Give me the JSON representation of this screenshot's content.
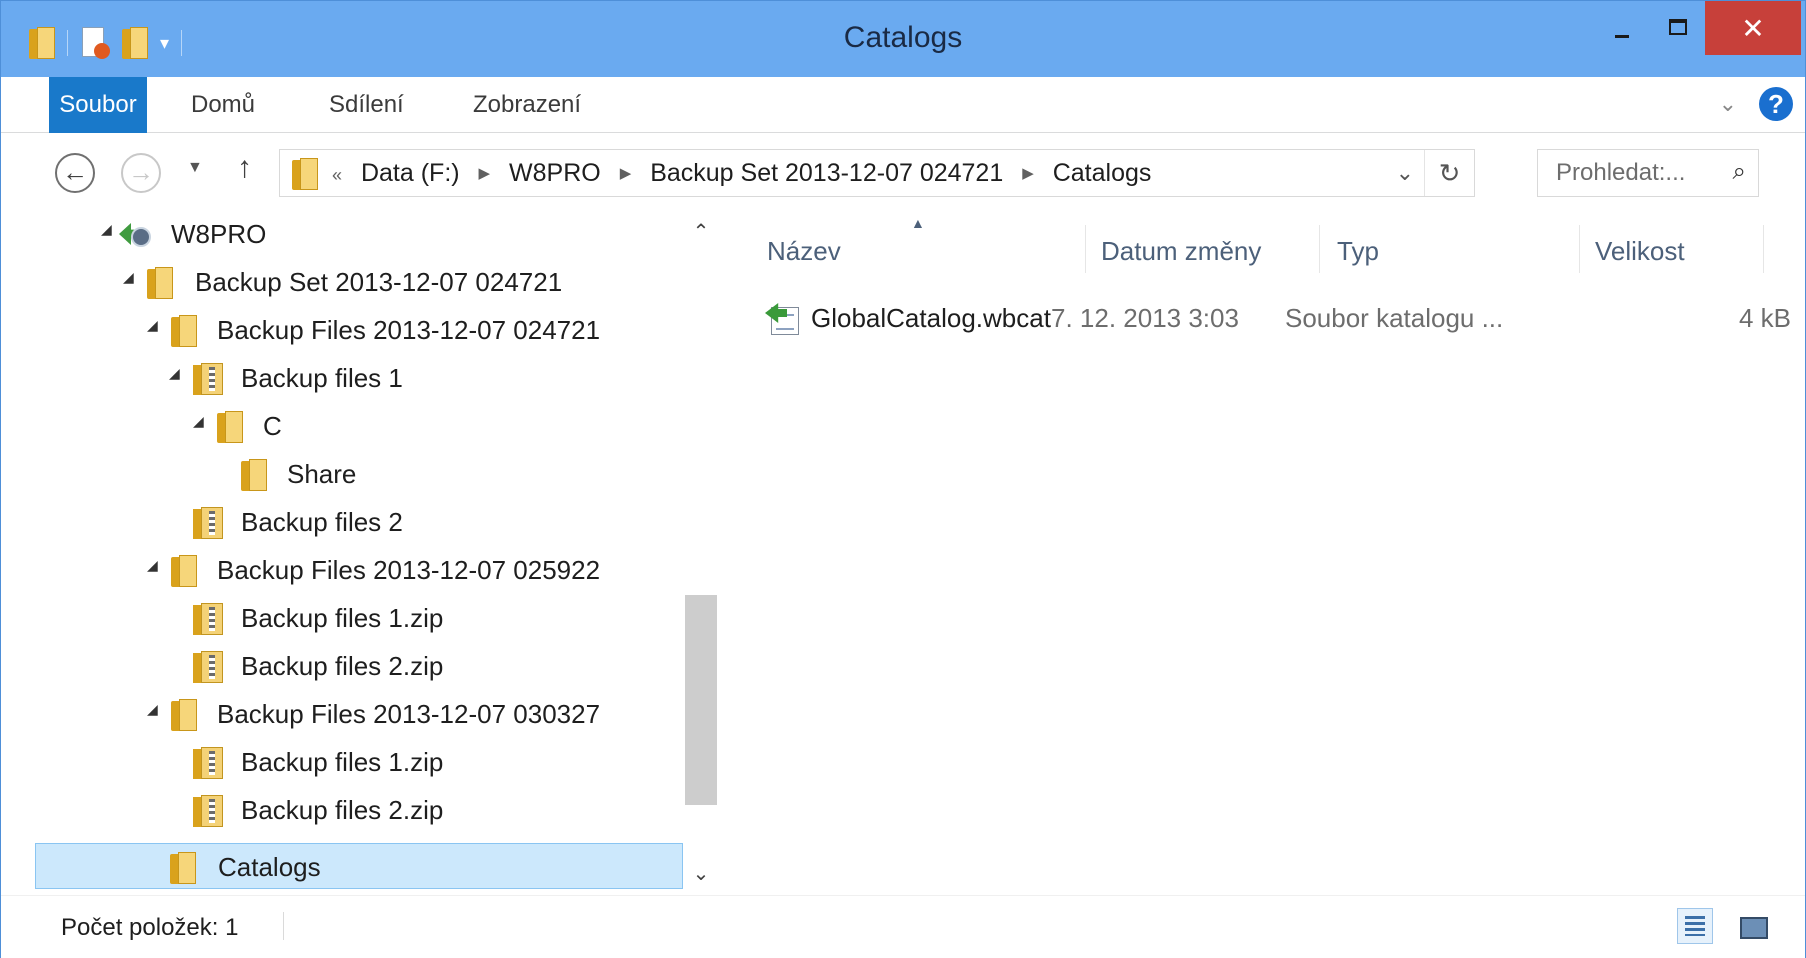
{
  "window": {
    "title": "Catalogs"
  },
  "ribbon": {
    "tabs": [
      {
        "label": "Soubor"
      },
      {
        "label": "Domů"
      },
      {
        "label": "Sdílení"
      },
      {
        "label": "Zobrazení"
      }
    ],
    "help_label": "?"
  },
  "navigation": {
    "address_parts": [
      "«",
      "Data (F:)",
      "W8PRO",
      "Backup Set 2013-12-07 024721",
      "Catalogs"
    ],
    "search_placeholder": "Prohledat:..."
  },
  "tree": {
    "items": [
      {
        "label": "W8PRO",
        "icon": "computer-backup-icon"
      },
      {
        "label": "Backup Set 2013-12-07 024721",
        "icon": "folder-icon"
      },
      {
        "label": "Backup Files 2013-12-07 024721",
        "icon": "folder-icon"
      },
      {
        "label": "Backup files 1",
        "icon": "zip-folder-icon"
      },
      {
        "label": "C",
        "icon": "folder-icon"
      },
      {
        "label": "Share",
        "icon": "folder-icon"
      },
      {
        "label": "Backup files 2",
        "icon": "zip-folder-icon"
      },
      {
        "label": "Backup Files 2013-12-07 025922",
        "icon": "folder-icon"
      },
      {
        "label": "Backup files 1.zip",
        "icon": "zip-folder-icon"
      },
      {
        "label": "Backup files 2.zip",
        "icon": "zip-folder-icon"
      },
      {
        "label": "Backup Files 2013-12-07 030327",
        "icon": "folder-icon"
      },
      {
        "label": "Backup files 1.zip",
        "icon": "zip-folder-icon"
      },
      {
        "label": "Backup files 2.zip",
        "icon": "zip-folder-icon"
      },
      {
        "label": "Catalogs",
        "icon": "folder-icon",
        "selected": true
      }
    ]
  },
  "file_list": {
    "columns": [
      {
        "label": "Název"
      },
      {
        "label": "Datum změny"
      },
      {
        "label": "Typ"
      },
      {
        "label": "Velikost"
      }
    ],
    "rows": [
      {
        "name": "GlobalCatalog.wbcat",
        "date": "7. 12. 2013 3:03",
        "type": "Soubor katalogu ...",
        "size": "4 kB",
        "icon": "backup-catalog-icon"
      }
    ]
  },
  "status_bar": {
    "item_count": "Počet položek: 1"
  },
  "colors": {
    "title_bar": "#6aaaf0",
    "file_tab": "#1979ca",
    "close_button": "#c7403a",
    "selection": "#cce8fc"
  }
}
